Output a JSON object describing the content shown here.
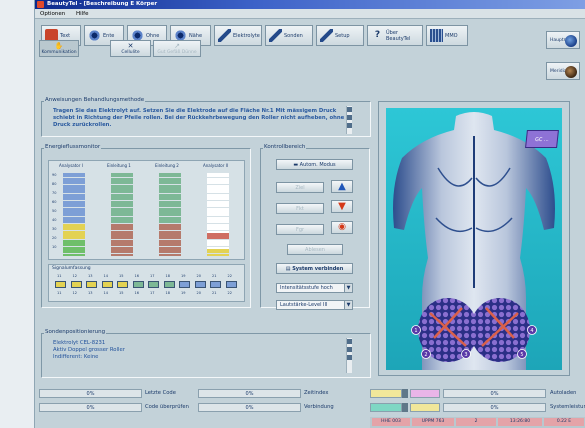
{
  "window": {
    "title": "BeautyTel - [Beschreibung E Körper"
  },
  "menu": [
    "Optionen",
    "Hilfe"
  ],
  "toolbar": [
    {
      "label": "Text",
      "icon": "red"
    },
    {
      "label": "Ente",
      "icon": "gear"
    },
    {
      "label": "Ohne",
      "icon": "gear"
    },
    {
      "label": "Nähe",
      "icon": "gear"
    },
    {
      "label": "Elektrolyte",
      "icon": "tool"
    },
    {
      "label": "Sonden",
      "icon": "tool"
    },
    {
      "label": "Setup",
      "icon": "tool"
    },
    {
      "label": "Über BeautyTel",
      "icon": "q"
    },
    {
      "label": "MMO",
      "icon": "pict"
    }
  ],
  "side_buttons": [
    "Hauptmenü",
    "Meridiane"
  ],
  "tabs": [
    {
      "label": "Kommunikation",
      "active": true
    },
    {
      "label": "Cellulite",
      "active": false
    },
    {
      "label": "Gut Gefäß Dünne",
      "active": false
    }
  ],
  "instructions": {
    "title": "Anweisungen Behandlungsmethode",
    "text": "Tragen Sie das Elektrolyt auf. Setzen Sie die Elektrode auf die Fläche Nr.1 Mit mässigem Druck schiebt in Richtung der Pfeile rollen. Bei der Rückkehrbewegung den Roller nicht aufheben, ohne Druck zurückrollen."
  },
  "energy": {
    "title": "Energieflussmonitor",
    "columns": [
      "Analysator I",
      "Einleitung 1",
      "Einleitung 2",
      "Analysator II"
    ],
    "scale": [
      "90",
      "80",
      "70",
      "60",
      "50",
      "40",
      "30",
      "20",
      "10"
    ],
    "signal_label": "Signalumfassung",
    "signal_top": [
      "11",
      "12",
      "13",
      "14",
      "15",
      "16",
      "17",
      "18",
      "19",
      "20",
      "21",
      "22"
    ],
    "signal_bottom": [
      "11",
      "12",
      "13",
      "14",
      "15",
      "16",
      "17",
      "18",
      "19",
      "20",
      "21",
      "22"
    ]
  },
  "control": {
    "title": "Kontrollbereich",
    "auto_mode": "Autom. Modus",
    "disabled_1": "Ziel",
    "disabled_2": "Fkt",
    "disabled_3": "Fgr",
    "disabled_4": "Ablesen",
    "connect": "System verbinden",
    "select1": "Intensitätsstufe hoch",
    "select2": "Lautstärke-Level III"
  },
  "probes": {
    "title": "Sondenpositionierung",
    "lines": [
      "Elektrolyt   CEL-8231",
      "Aktiv    Doppel grosser Roller",
      "Indifferent: Keine"
    ]
  },
  "body_image": {
    "badge": "GC ...",
    "markers": [
      "1",
      "2",
      "3",
      "4",
      "5"
    ]
  },
  "status": {
    "row1": {
      "val1": "0%",
      "label1": "Letzte Code",
      "val2": "0%",
      "label2": "Zeitindex",
      "val3": "0%",
      "label3": "Autoladen"
    },
    "row2": {
      "val1": "0%",
      "label1": "Code überprüfen",
      "val2": "0%",
      "label2": "Verbindung",
      "val3": "0%",
      "label3": "Systemleistung"
    },
    "readouts": [
      "HHE 003",
      "UPPM 763",
      "2",
      "13:26:80",
      "0.22 E"
    ]
  },
  "colors": {
    "accent": "#1b3a6a",
    "panel": "#c3d2d9",
    "titlebar": "#0d2a8c"
  }
}
